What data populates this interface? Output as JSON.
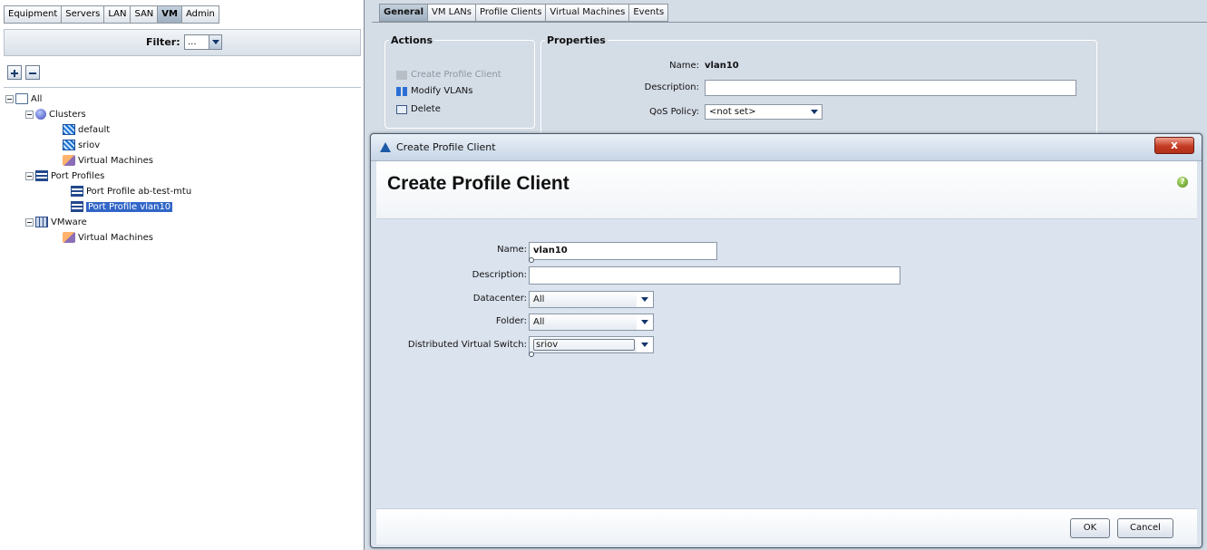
{
  "left_tabs": [
    "Equipment",
    "Servers",
    "LAN",
    "SAN",
    "VM",
    "Admin"
  ],
  "left_active_tab": "VM",
  "filter": {
    "label": "Filter:",
    "value": "..."
  },
  "tree": {
    "all": "All",
    "clusters": "Clusters",
    "cluster_default": "default",
    "cluster_sriov": "sriov",
    "cluster_vms": "Virtual Machines",
    "port_profiles": "Port Profiles",
    "pp_ab_test": "Port Profile ab-test-mtu",
    "pp_vlan10": "Port Profile vlan10",
    "vmware": "VMware",
    "vmware_vms": "Virtual Machines"
  },
  "right_tabs": [
    "General",
    "VM LANs",
    "Profile Clients",
    "Virtual Machines",
    "Events"
  ],
  "right_active_tab": "General",
  "actions": {
    "legend": "Actions",
    "create": "Create Profile Client",
    "modify": "Modify VLANs",
    "delete": "Delete"
  },
  "properties": {
    "legend": "Properties",
    "name_label": "Name:",
    "name_value": "vlan10",
    "description_label": "Description:",
    "qos_label": "QoS Policy:",
    "qos_value": "<not set>"
  },
  "modal": {
    "window_title": "Create Profile Client",
    "heading": "Create Profile Client",
    "close_glyph": "x",
    "help_glyph": "?",
    "fields": {
      "name_label": "Name:",
      "name_value": "vlan10",
      "description_label": "Description:",
      "description_value": "",
      "datacenter_label": "Datacenter:",
      "datacenter_value": "All",
      "folder_label": "Folder:",
      "folder_value": "All",
      "dvs_label": "Distributed Virtual Switch:",
      "dvs_value": "sriov"
    },
    "ok_label": "OK",
    "cancel_label": "Cancel"
  },
  "colors": {
    "selection": "#3166c8",
    "background": "#d4dce6",
    "close_button": "#c43b22",
    "help_icon": "#4f8c1a"
  },
  "icons": {
    "tree_all": "folder-icon",
    "tree_clusters": "cluster-icon",
    "tree_switch": "switch-icon",
    "tree_vm": "vm-icon",
    "tree_port_profile": "port-profile-icon",
    "tree_vmware": "vmware-icon"
  }
}
